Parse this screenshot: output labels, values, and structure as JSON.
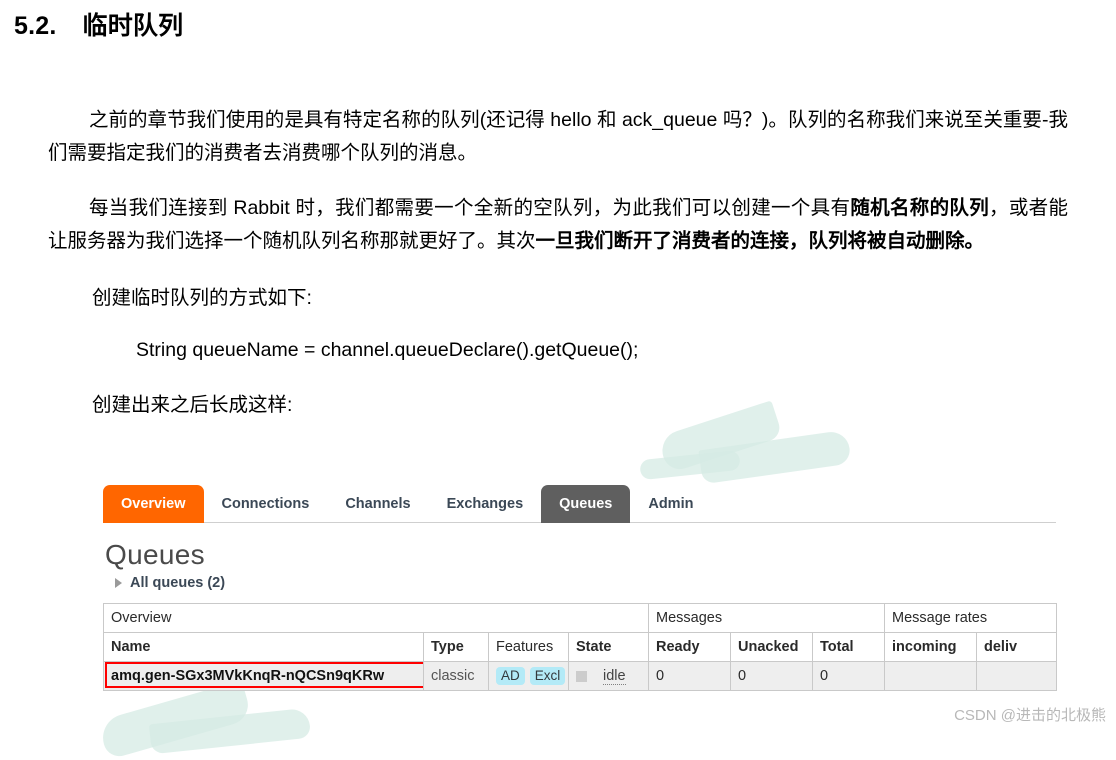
{
  "document": {
    "heading_number": "5.2.",
    "heading_title": "临时队列",
    "paragraphs": {
      "p1_part1": "之前的章节我们使用的是具有特定名称的队列(还记得 hello 和 ack_queue 吗？)。队列的名称我们来说至关重要-我们需要指定我们的消费者去消费哪个队列的消息。",
      "p2_part1": "每当我们连接到 Rabbit 时，我们都需要一个全新的空队列，为此我们可以创建一个具有",
      "p2_bold1": "随机名称的队列",
      "p2_part2": "，或者能让服务器为我们选择一个随机队列名称那就更好了。其次",
      "p2_bold2": "一旦我们断开了消费者的连接，队列将被自动删除。",
      "p3": "创建临时队列的方式如下:",
      "code": "String queueName = channel.queueDeclare().getQueue();",
      "p4": "创建出来之后长成这样:"
    }
  },
  "rabbitmq": {
    "tabs": [
      {
        "label": "Overview",
        "state": "active"
      },
      {
        "label": "Connections",
        "state": "normal"
      },
      {
        "label": "Channels",
        "state": "normal"
      },
      {
        "label": "Exchanges",
        "state": "normal"
      },
      {
        "label": "Queues",
        "state": "selected"
      },
      {
        "label": "Admin",
        "state": "normal"
      }
    ],
    "page_title": "Queues",
    "all_queues_label": "All queues (2)",
    "table": {
      "group_headers": {
        "overview": "Overview",
        "messages": "Messages",
        "message_rates": "Message rates"
      },
      "columns": {
        "name": "Name",
        "type": "Type",
        "features": "Features",
        "state": "State",
        "ready": "Ready",
        "unacked": "Unacked",
        "total": "Total",
        "incoming": "incoming",
        "deliver": "deliv"
      },
      "rows": [
        {
          "name": "amq.gen-SGx3MVkKnqR-nQCSn9qKRw",
          "type": "classic",
          "features": [
            "AD",
            "Excl"
          ],
          "state": "idle",
          "ready": "0",
          "unacked": "0",
          "total": "0",
          "incoming": "",
          "deliver": ""
        }
      ]
    },
    "colors": {
      "tab_active": "#ff6600",
      "tab_selected": "#5f5f5f",
      "badge": "#b3eaf7",
      "highlight": "#ff0000"
    }
  },
  "watermark": {
    "csdn": "CSDN @进击的北极熊"
  }
}
